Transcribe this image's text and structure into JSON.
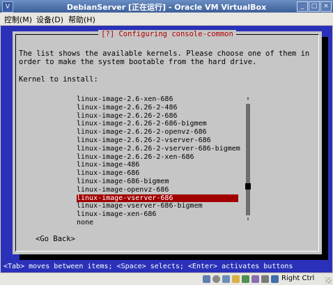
{
  "window": {
    "title": "DebianServer [正在运行] - Oracle VM VirtualBox",
    "icon": "virtualbox-icon",
    "controls": [
      "minimize-icon",
      "maximize-icon",
      "close-icon"
    ]
  },
  "menu": [
    {
      "label": "控制(M)"
    },
    {
      "label": "设备(D)"
    },
    {
      "label": "帮助(H)"
    }
  ],
  "dialog": {
    "title": "[?] Configuring console-common",
    "description_line1": "The list shows the available kernels. Please choose one of them in",
    "description_line2": "order to make the system bootable from the hard drive.",
    "prompt": "Kernel to install:",
    "items": [
      {
        "label": "linux-image-2.6-xen-686"
      },
      {
        "label": "linux-image-2.6.26-2-486"
      },
      {
        "label": "linux-image-2.6.26-2-686"
      },
      {
        "label": "linux-image-2.6.26-2-686-bigmem"
      },
      {
        "label": "linux-image-2.6.26-2-openvz-686"
      },
      {
        "label": "linux-image-2.6.26-2-vserver-686"
      },
      {
        "label": "linux-image-2.6.26-2-vserver-686-bigmem"
      },
      {
        "label": "linux-image-2.6.26-2-xen-686"
      },
      {
        "label": "linux-image-486"
      },
      {
        "label": "linux-image-686"
      },
      {
        "label": "linux-image-686-bigmem"
      },
      {
        "label": "linux-image-openvz-686"
      },
      {
        "label": "linux-image-vserver-686"
      },
      {
        "label": "linux-image-vserver-686-bigmem"
      },
      {
        "label": "linux-image-xen-686"
      },
      {
        "label": "none"
      }
    ],
    "selected_item": "linux-image-vserver-686",
    "scroll_up": "↑",
    "scroll_down": "↓",
    "back_button": "<Go Back>"
  },
  "hint": "<Tab> moves between items; <Space> selects; <Enter> activates buttons",
  "status": {
    "icons": [
      "hard-disk-icon",
      "optical-drive-icon",
      "usb-icon",
      "shared-folder-icon",
      "network-icon",
      "capture-icon",
      "mouse-integration-icon",
      "keyboard-icon"
    ],
    "host_key": "Right Ctrl"
  },
  "colors": {
    "screen_bg": "#2a31b8",
    "dialog_bg": "#c6c6c6",
    "selection_bg": "#a00000",
    "title_red": "#b00000"
  }
}
